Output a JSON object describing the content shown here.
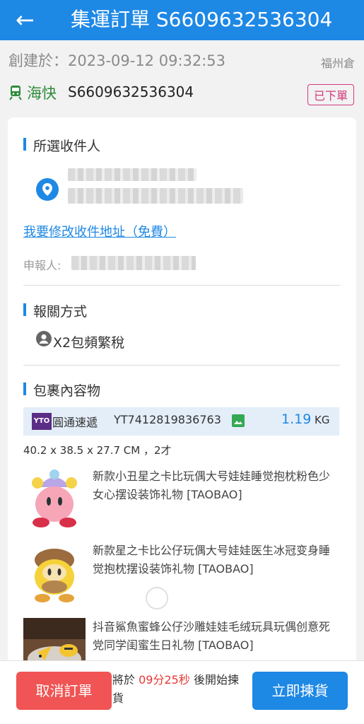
{
  "header": {
    "back_icon": "arrow-left-icon",
    "title": "集運訂單 S6609632536304"
  },
  "order": {
    "created_label": "創建於：",
    "created_at": "2023-09-12 09:32:53",
    "warehouse": "福州倉",
    "ship_icon": "train-icon",
    "ship_method": "海快",
    "ship_number": "S6609632536304",
    "status": "已下單",
    "status_color": "#d23b7b"
  },
  "recipient": {
    "section_title": "所選收件人",
    "location_icon": "location-pin-icon",
    "edit_address_link": "我要修改收件地址（免費）",
    "declarant_label": "申報人:"
  },
  "customs": {
    "section_title": "報關方式",
    "icon": "user-circle-icon",
    "method": "X2包頻繁稅"
  },
  "package": {
    "section_title": "包裹內容物",
    "courier_logo_text": "YTO",
    "courier_name": "圓通速遞",
    "tracking_number": "YT7412819836763",
    "photo_icon": "image-icon",
    "weight": "1.19",
    "weight_unit": "KG",
    "dimensions": "40.2 x 38.5 x 27.7 CM ，2才",
    "items": [
      {
        "name": "新款小丑星之卡比玩偶大号娃娃睡觉抱枕粉色少女心摆设装饰礼物 [TAOBAO]"
      },
      {
        "name": "新款星之卡比公仔玩偶大号娃娃医生冰冠变身睡觉抱枕摆设装饰礼物 [TAOBAO]"
      },
      {
        "name": "抖音鯊魚蜜蜂公仔沙雕娃娃毛绒玩具玩偶创意死党同学闺蜜生日礼物 [TAOBAO]"
      }
    ]
  },
  "footer": {
    "cancel_label": "取消訂單",
    "countdown_prefix": "將於",
    "countdown_time": "09分25秒",
    "countdown_suffix": "後開始揀貨",
    "pick_label": "立即揀貨"
  },
  "colors": {
    "primary": "#1e88e5",
    "danger": "#f05454",
    "ship_green": "#2e8b3c"
  }
}
